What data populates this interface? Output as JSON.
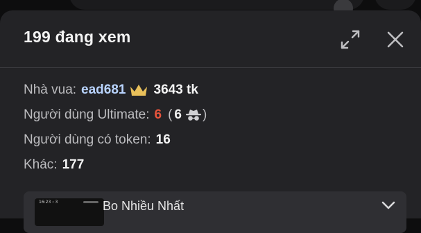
{
  "header": {
    "title": "199 đang xem"
  },
  "stats": {
    "king_label": "Nhà vua:",
    "king_name": "ead681",
    "king_tokens": "3643 tk",
    "ultimate_label": "Người dùng Ultimate:",
    "ultimate_count": "6",
    "ultimate_open_paren": "(",
    "ultimate_incognito_count": "6",
    "ultimate_close_paren": ")",
    "token_label": "Người dùng có token:",
    "token_count": "16",
    "other_label": "Khác:",
    "other_count": "177"
  },
  "card": {
    "title_partial": "Bo Nhiều Nhất",
    "thumb_time": "16:23 ‹ 3"
  },
  "icons": {
    "expand": "expand-icon",
    "close": "close-icon",
    "crown": "crown-icon",
    "incognito": "incognito-icon",
    "chevron": "chevron-down-icon"
  },
  "colors": {
    "panel": "#232326",
    "king_name": "#b9d4ff",
    "ultimate_count": "#e8543c",
    "crown": "#e9c05a"
  }
}
